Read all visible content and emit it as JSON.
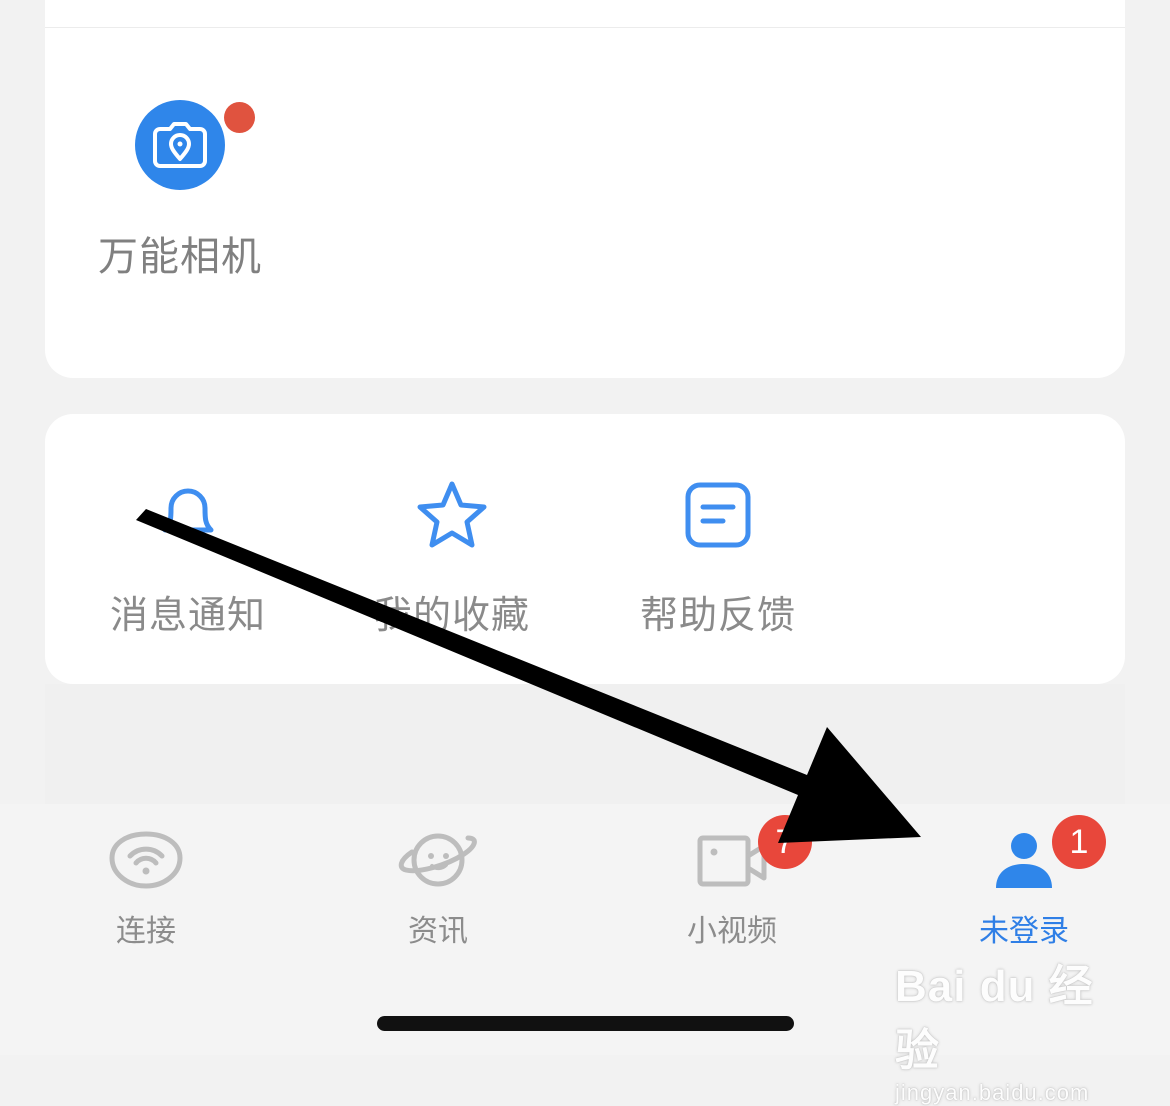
{
  "tools": {
    "camera_label": "万能相机"
  },
  "functions": {
    "notifications_label": "消息通知",
    "favorites_label": "我的收藏",
    "help_label": "帮助反馈"
  },
  "tabbar": {
    "connect_label": "连接",
    "news_label": "资讯",
    "video_label": "小视频",
    "video_badge": "7",
    "login_label": "未登录",
    "login_badge": "1"
  },
  "watermark": {
    "main": "Bai du 经验",
    "sub": "jingyan.baidu.com"
  },
  "colors": {
    "accent": "#2f86ea",
    "badge": "#e8473b",
    "dot": "#e0533f"
  }
}
